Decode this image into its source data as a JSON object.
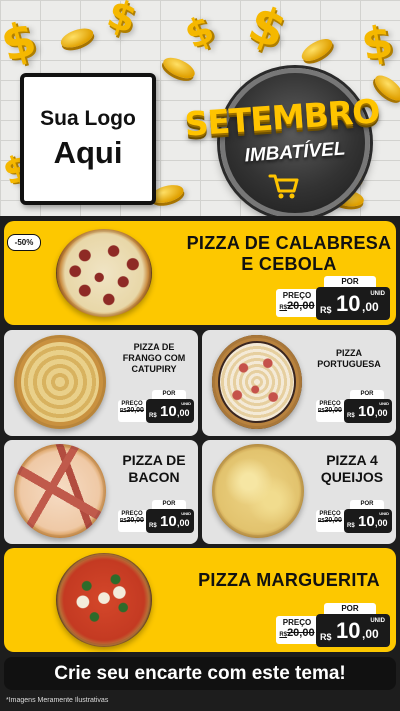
{
  "header": {
    "logo_line1": "Sua Logo",
    "logo_line2": "Aqui",
    "campaign_title": "SETEMBRO",
    "campaign_subtitle": "IMBATÍVEL"
  },
  "colors": {
    "accent": "#fdc800",
    "dark": "#111111",
    "card_gray": "#e3e3e3"
  },
  "discount_badge": "-50%",
  "price_labels": {
    "preco": "PREÇO",
    "por": "POR",
    "currency": "R$",
    "unit": "UNID"
  },
  "products": {
    "calabresa": {
      "name_line1": "PIZZA DE CALABRESA",
      "name_line2": "E CEBOLA",
      "old_price": "20,00",
      "new_int": "10",
      "new_dec": ",00"
    },
    "frango": {
      "name_line1": "PIZZA DE",
      "name_line2": "FRANGO COM",
      "name_line3": "CATUPIRY",
      "old_price": "20,00",
      "new_int": "10",
      "new_dec": ",00"
    },
    "portuguesa": {
      "name_line1": "PIZZA",
      "name_line2": "PORTUGUESA",
      "old_price": "20,00",
      "new_int": "10",
      "new_dec": ",00"
    },
    "bacon": {
      "name_line1": "PIZZA DE",
      "name_line2": "BACON",
      "old_price": "20,00",
      "new_int": "10",
      "new_dec": ",00"
    },
    "queijos": {
      "name_line1": "PIZZA 4",
      "name_line2": "QUEIJOS",
      "old_price": "20,00",
      "new_int": "10",
      "new_dec": ",00"
    },
    "marguerita": {
      "name_line1": "PIZZA MARGUERITA",
      "old_price": "20,00",
      "new_int": "10",
      "new_dec": ",00"
    }
  },
  "cta": "Crie seu encarte com este tema!",
  "footnote": "*Imagens Meramente Ilustrativas"
}
